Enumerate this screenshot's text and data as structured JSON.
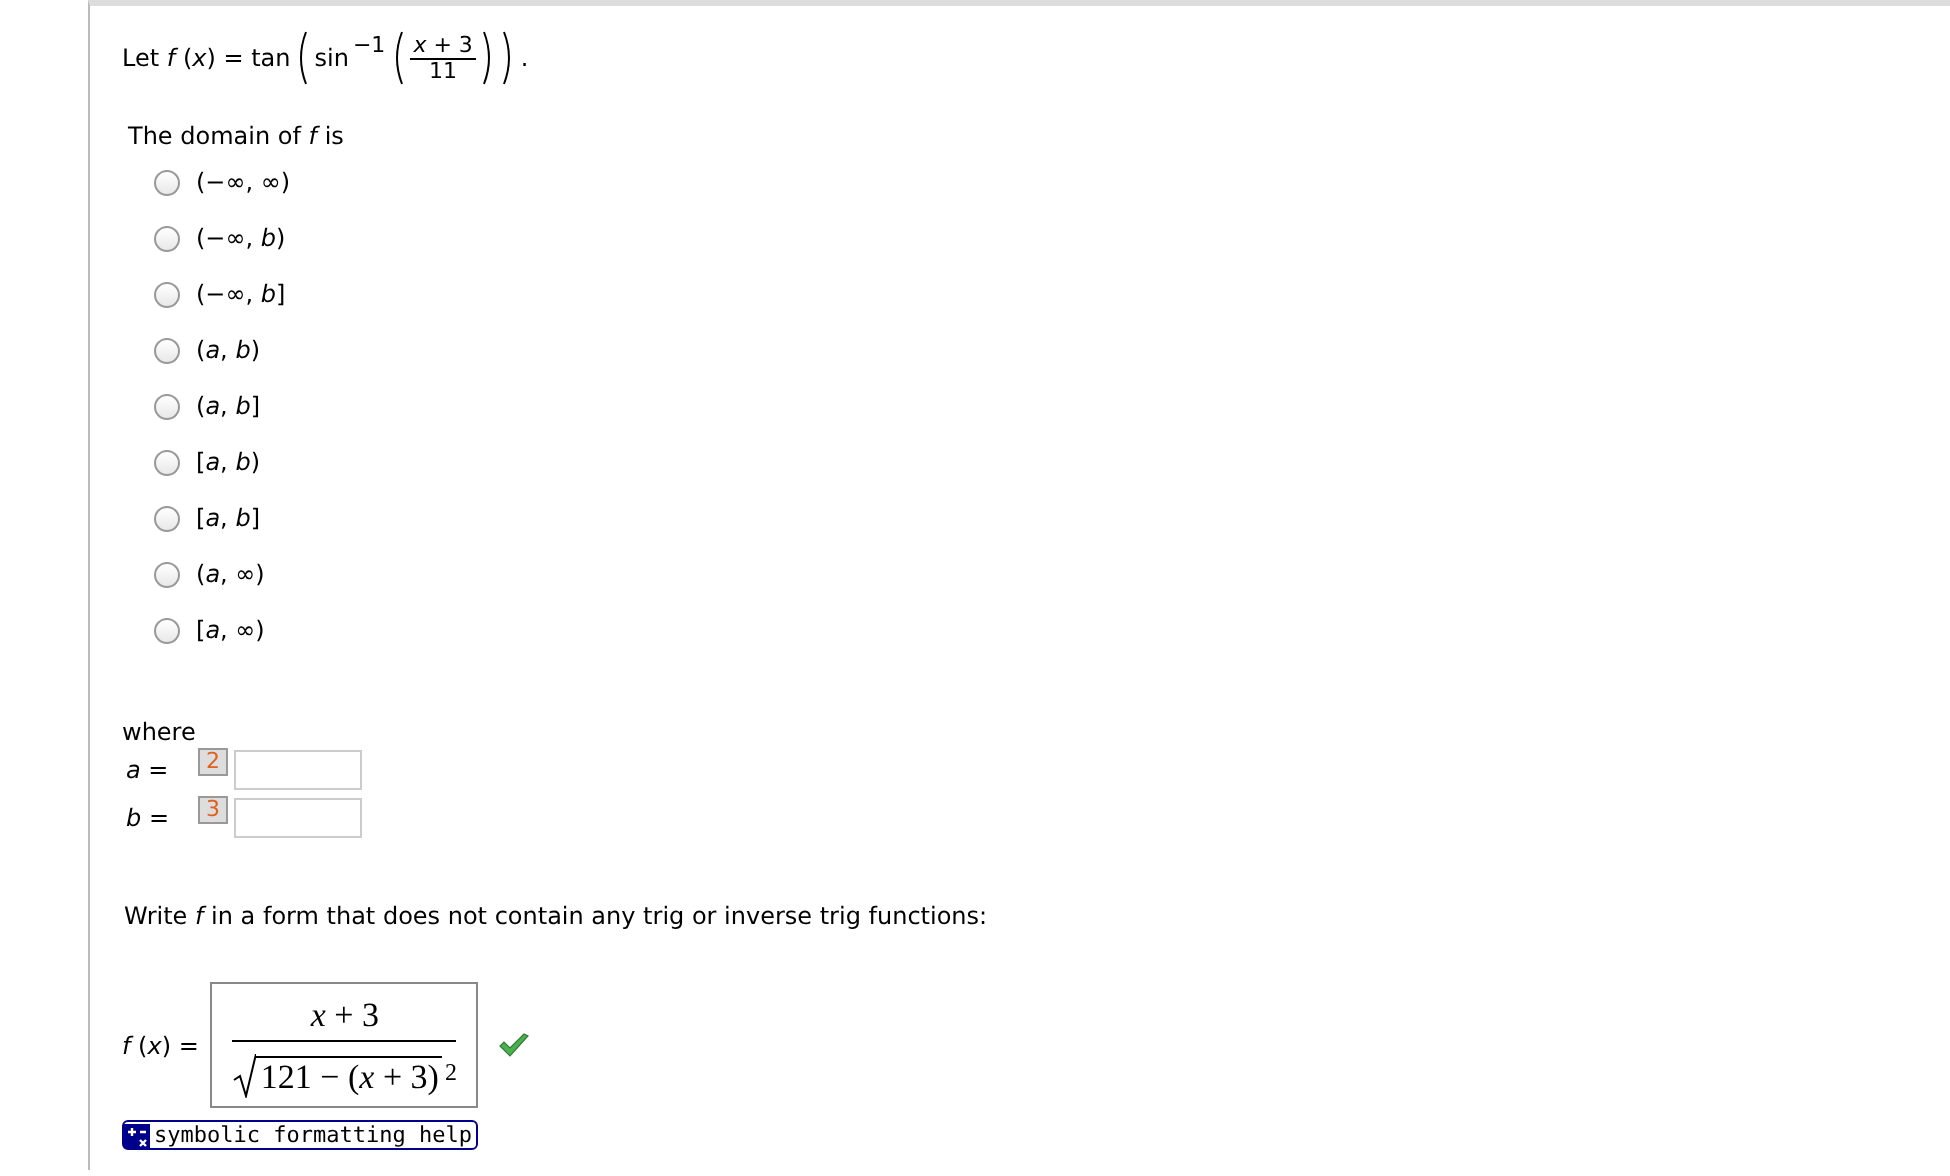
{
  "question": {
    "lead": "Let *f* (*x*) = tan",
    "func": "sin",
    "power": "−1",
    "numerator": "*x* + 3",
    "denominator": "11",
    "end": "."
  },
  "domain_prompt": "The domain of *f* is",
  "options": [
    {
      "label": "(−∞, ∞)",
      "selected": false
    },
    {
      "label": "(−∞, *b*)",
      "selected": false
    },
    {
      "label": "(−∞, *b*]",
      "selected": false
    },
    {
      "label": "(*a*, *b*)",
      "selected": false
    },
    {
      "label": "(*a*, *b*]",
      "selected": false
    },
    {
      "label": "[*a*, *b*)",
      "selected": false
    },
    {
      "label": "[*a*, *b*]",
      "selected": false
    },
    {
      "label": "(*a*, ∞)",
      "selected": false
    },
    {
      "label": "[*a*, ∞)",
      "selected": false
    }
  ],
  "where": "where",
  "params": [
    {
      "label": "*a* =",
      "badge": "2"
    },
    {
      "label": "*b* =",
      "badge": "3"
    }
  ],
  "prompt": "Write *f* in a form that does not contain any trig or inverse trig functions:",
  "answer": {
    "label": "*f* (*x*) =",
    "numerator": "*x* + 3",
    "radicand": "121 − (*x* + 3)",
    "exponent": "2",
    "correct": true
  },
  "help_link": "symbolic formatting help"
}
